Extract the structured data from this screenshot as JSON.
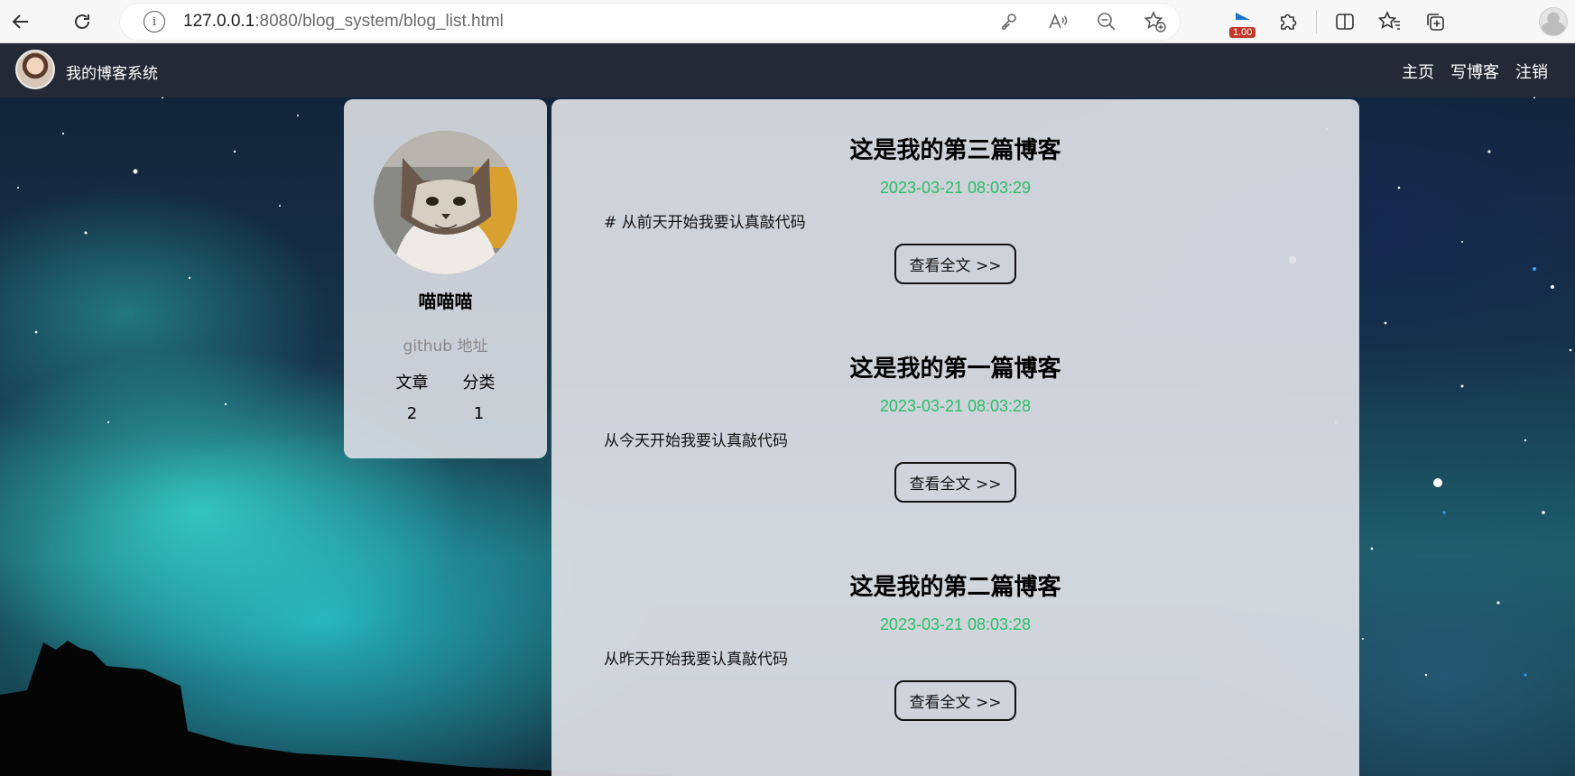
{
  "browser": {
    "url_host": "127.0.0.1",
    "url_rest": ":8080/blog_system/blog_list.html",
    "extension_badge": "1.00"
  },
  "site": {
    "title": "我的博客系统",
    "nav": [
      "主页",
      "写博客",
      "注销"
    ]
  },
  "profile": {
    "name": "喵喵喵",
    "github": "github 地址",
    "stats_labels": [
      "文章",
      "分类"
    ],
    "stats_values": [
      "2",
      "1"
    ]
  },
  "posts": [
    {
      "title": "这是我的第三篇博客",
      "date": "2023-03-21 08:03:29",
      "desc": "# 从前天开始我要认真敲代码",
      "button": "查看全文 >>"
    },
    {
      "title": "这是我的第一篇博客",
      "date": "2023-03-21 08:03:28",
      "desc": "从今天开始我要认真敲代码",
      "button": "查看全文 >>"
    },
    {
      "title": "这是我的第二篇博客",
      "date": "2023-03-21 08:03:28",
      "desc": "从昨天开始我要认真敲代码",
      "button": "查看全文 >>"
    }
  ],
  "colors": {
    "date_green": "#2dbb6a",
    "nav_bg": "#282c34"
  }
}
